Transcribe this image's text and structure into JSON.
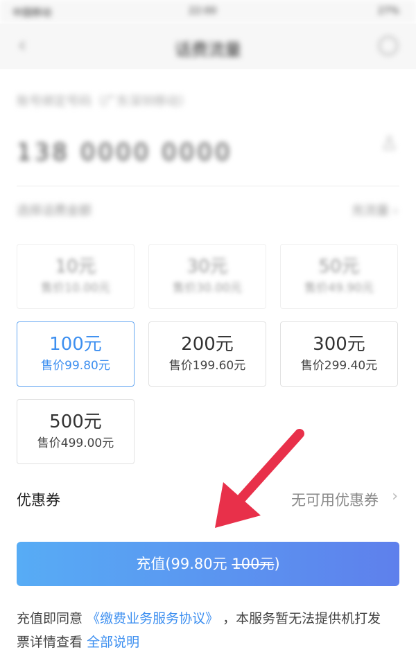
{
  "status_bar": {
    "carrier": "中国移动",
    "time": "22:00",
    "battery": "27%"
  },
  "nav": {
    "title": "话费流量"
  },
  "account": {
    "label": "账号绑定号码（广东深圳移动）",
    "number": "138 0000 0000"
  },
  "section": {
    "label": "选择话费金额",
    "link": "充流量 ›"
  },
  "cards": [
    {
      "amount": "10元",
      "price": "售价10.00元"
    },
    {
      "amount": "30元",
      "price": "售价30.00元"
    },
    {
      "amount": "50元",
      "price": "售价49.90元"
    },
    {
      "amount": "100元",
      "price": "售价99.80元"
    },
    {
      "amount": "200元",
      "price": "售价199.60元"
    },
    {
      "amount": "300元",
      "price": "售价299.40元"
    },
    {
      "amount": "500元",
      "price": "售价499.00元"
    }
  ],
  "coupon": {
    "label": "优惠券",
    "value": "无可用优惠券"
  },
  "pay_button": {
    "prefix": "充值(99.80元 ",
    "original": "100元",
    "suffix": ")"
  },
  "agreement": {
    "prefix": "充值即同意",
    "link": "《缴费业务服务协议》",
    "middle": "，本服务暂无法提供机打发",
    "line2": "票详情查看",
    "more_link": "全部说明"
  },
  "colors": {
    "accent": "#3d8ff0",
    "arrow": "#e8304a",
    "button_start": "#57acf5",
    "button_end": "#5e80ec"
  }
}
